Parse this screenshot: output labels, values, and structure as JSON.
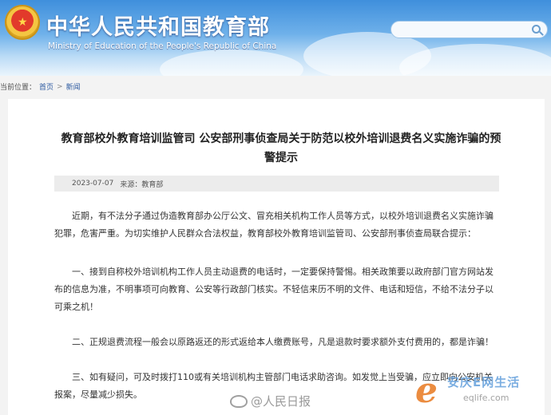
{
  "header": {
    "title": "中华人民共和国教育部",
    "subtitle": "Ministry of Education of the People's Republic of China"
  },
  "breadcrumb": {
    "prefix": "当前位置：",
    "home": "首页",
    "section": "新闻"
  },
  "article": {
    "title": "教育部校外教育培训监管司 公安部刑事侦查局关于防范以校外培训退费名义实施诈骗的预警提示",
    "date": "2023-07-07",
    "source": "来源：教育部",
    "paragraphs": [
      "近期，有不法分子通过伪造教育部办公厅公文、冒充相关机构工作人员等方式，以校外培训退费名义实施诈骗犯罪，危害严重。为切实维护人民群众合法权益，教育部校外教育培训监管司、公安部刑事侦查局联合提示：",
      "一、接到自称校外培训机构工作人员主动退费的电话时，一定要保持警惕。相关政策要以政府部门官方网站发布的信息为准，不明事项可向教育、公安等行政部门核实。不轻信来历不明的文件、电话和短信，不给不法分子以可乘之机！",
      "二、正规退费流程一般会以原路返还的形式返给本人缴费账号，凡是退款时要求额外支付费用的，都是诈骗！",
      "三、如有疑问，可及时拨打110或有关培训机构主管部门电话求助咨询。如发觉上当受骗，应立即向公安机关报案，尽量减少损失。"
    ]
  },
  "watermarks": {
    "people_daily": "@人民日报",
    "site_name": "安庆E网生活",
    "site_url": "eqlife.com"
  },
  "colors": {
    "header_top": "#3f8fdc",
    "link": "#2c5aa0",
    "meta_bg": "#ececec"
  }
}
